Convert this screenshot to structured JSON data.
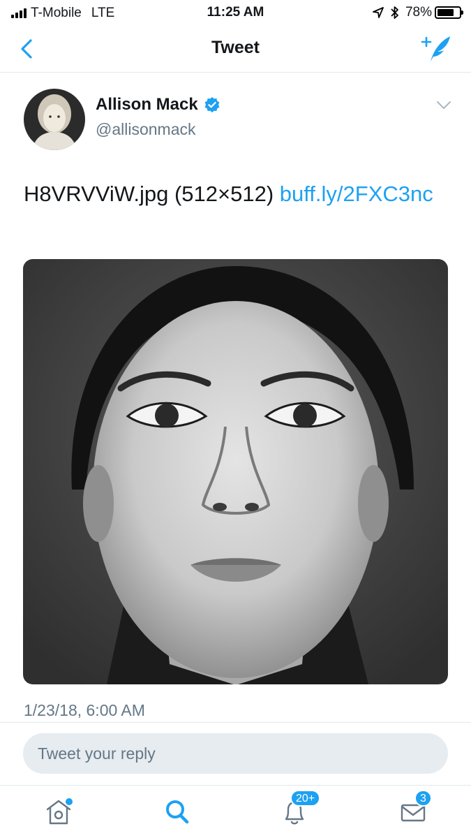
{
  "status_bar": {
    "carrier": "T-Mobile",
    "network": "LTE",
    "time": "11:25 AM",
    "battery": "78%",
    "battery_level": 0.78,
    "icons": [
      "signal-bars-icon",
      "location-arrow-icon",
      "bluetooth-icon",
      "battery-icon"
    ]
  },
  "nav": {
    "title": "Tweet",
    "back_icon": "chevron-left-icon",
    "compose_icon": "compose-tweet-icon"
  },
  "tweet": {
    "author_name": "Allison Mack",
    "author_handle": "@allisonmack",
    "verified": true,
    "text": "H8VRVViW.jpg (512×512) ",
    "link_text": "buff.ly/2FXC3nc",
    "timestamp": "1/23/18, 6:00 AM",
    "menu_icon": "chevron-down-icon",
    "media_icon": "photo-portrait"
  },
  "reply": {
    "placeholder": "Tweet your reply"
  },
  "tabbar": {
    "tabs": [
      {
        "name": "home",
        "icon": "home-icon",
        "badge": ""
      },
      {
        "name": "search",
        "icon": "search-icon",
        "badge": ""
      },
      {
        "name": "notifications",
        "icon": "bell-icon",
        "badge": "20+"
      },
      {
        "name": "messages",
        "icon": "envelope-icon",
        "badge": "3"
      }
    ]
  },
  "colors": {
    "accent": "#1da1f2",
    "text": "#14171a",
    "secondary": "#657786",
    "divider": "#e1e8ed",
    "input_bg": "#e6ecf0"
  }
}
